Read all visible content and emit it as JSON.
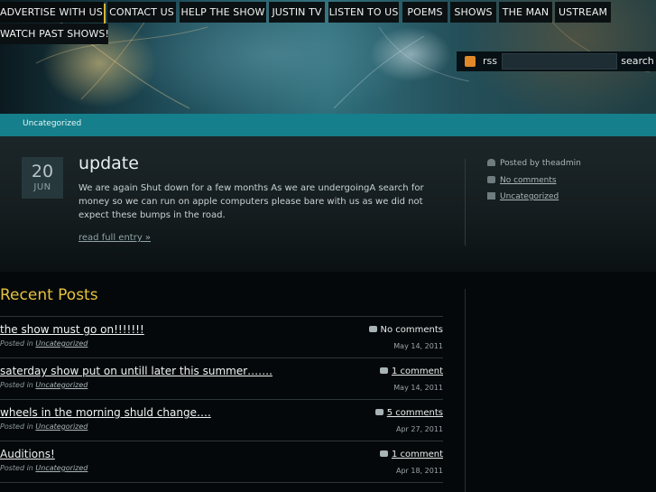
{
  "nav": {
    "items": [
      {
        "label": "ADVERTISE WITH US!"
      },
      {
        "label": "CONTACT US"
      },
      {
        "label": "HELP THE SHOW"
      },
      {
        "label": "JUSTIN TV"
      },
      {
        "label": "LISTEN TO US"
      },
      {
        "label": "POEMS"
      },
      {
        "label": "SHOWS"
      },
      {
        "label": "THE MAN"
      },
      {
        "label": "USTREAM"
      },
      {
        "label": "WATCH PAST SHOWS!"
      }
    ]
  },
  "search": {
    "rss_label": "rss",
    "input_value": "",
    "button_label": "search",
    "rss_icon": "rss-icon"
  },
  "category_bar": {
    "label": "Uncategorized"
  },
  "post": {
    "day": "20",
    "month": "JUN",
    "title": "update",
    "body": "We are again Shut down for a few months As we are undergoingA search for money so we can run on apple computers please bare with us as we did not expect these bumps in the road.",
    "read_more": "read full entry »",
    "meta": {
      "author": "Posted by theadmin",
      "comments": "No comments",
      "category": "Uncategorized",
      "author_icon": "person-icon",
      "comments_icon": "comment-bubble-icon",
      "category_icon": "folder-icon"
    }
  },
  "recent": {
    "heading": "Recent Posts",
    "posted_in": "Posted in",
    "items": [
      {
        "title": "the show must go on!!!!!!!",
        "category": "Uncategorized",
        "comments": "No comments",
        "date": "May 14, 2011"
      },
      {
        "title": "saterday show put on untill later this summer…….",
        "category": "Uncategorized",
        "comments": "1 comment",
        "date": "May 14, 2011"
      },
      {
        "title": "wheels in the morning shuld change….",
        "category": "Uncategorized",
        "comments": "5 comments",
        "date": "Apr 27, 2011"
      },
      {
        "title": "Auditions!",
        "category": "Uncategorized",
        "comments": "1 comment",
        "date": "Apr 18, 2011"
      }
    ]
  },
  "colors": {
    "accent_gold": "#d9b23a",
    "heading_gold": "#e6c23d",
    "teal_bar": "#157f8b",
    "rss_orange": "#e0892b"
  }
}
